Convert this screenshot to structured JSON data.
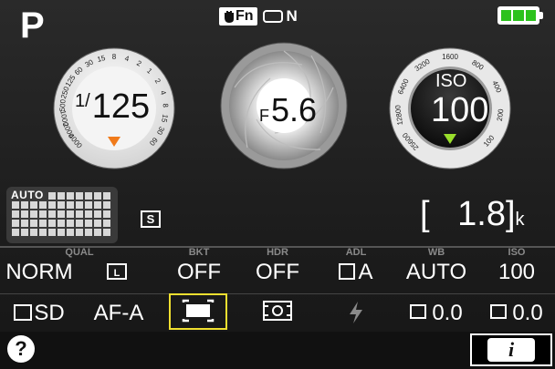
{
  "mode": "P",
  "top": {
    "fn_label": "Fn",
    "n_label": "N"
  },
  "shutter": {
    "fraction": "1/",
    "value": "125",
    "scale": [
      "4000",
      "2000",
      "1000",
      "500",
      "250",
      "125",
      "60",
      "30",
      "15",
      "8",
      "4",
      "2",
      "1",
      "2",
      "4",
      "8",
      "15",
      "30",
      "60"
    ]
  },
  "aperture": {
    "f_label": "F",
    "value": "5.6"
  },
  "iso": {
    "label": "ISO",
    "value": "100",
    "scale": [
      "25600",
      "12800",
      "6400",
      "3200",
      "1600",
      "800",
      "400",
      "200",
      "100"
    ]
  },
  "auto_label": "AUTO",
  "s_label": "S",
  "remaining": {
    "open": "[",
    "value": "1.8",
    "close": "]",
    "unit": "k"
  },
  "settings_row1": [
    {
      "header": "QUAL",
      "value": "NORM"
    },
    {
      "header": "",
      "value": "L"
    },
    {
      "header": "BKT",
      "value": "OFF"
    },
    {
      "header": "HDR",
      "value": "OFF"
    },
    {
      "header": "ADL",
      "value": "A"
    },
    {
      "header": "WB",
      "value": "AUTO"
    },
    {
      "header": "ISO",
      "value": "100"
    }
  ],
  "settings_row2": [
    {
      "value": "SD"
    },
    {
      "value": "AF-A"
    },
    {
      "value": ""
    },
    {
      "value": ""
    },
    {
      "value": ""
    },
    {
      "value": "0.0"
    },
    {
      "value": "0.0"
    }
  ],
  "help_label": "?",
  "info_label": "i",
  "colors": {
    "battery": "#2cc21d",
    "selection": "#f0e030",
    "iso_marker": "#9adf2c",
    "shutter_marker": "#f07a1a"
  }
}
